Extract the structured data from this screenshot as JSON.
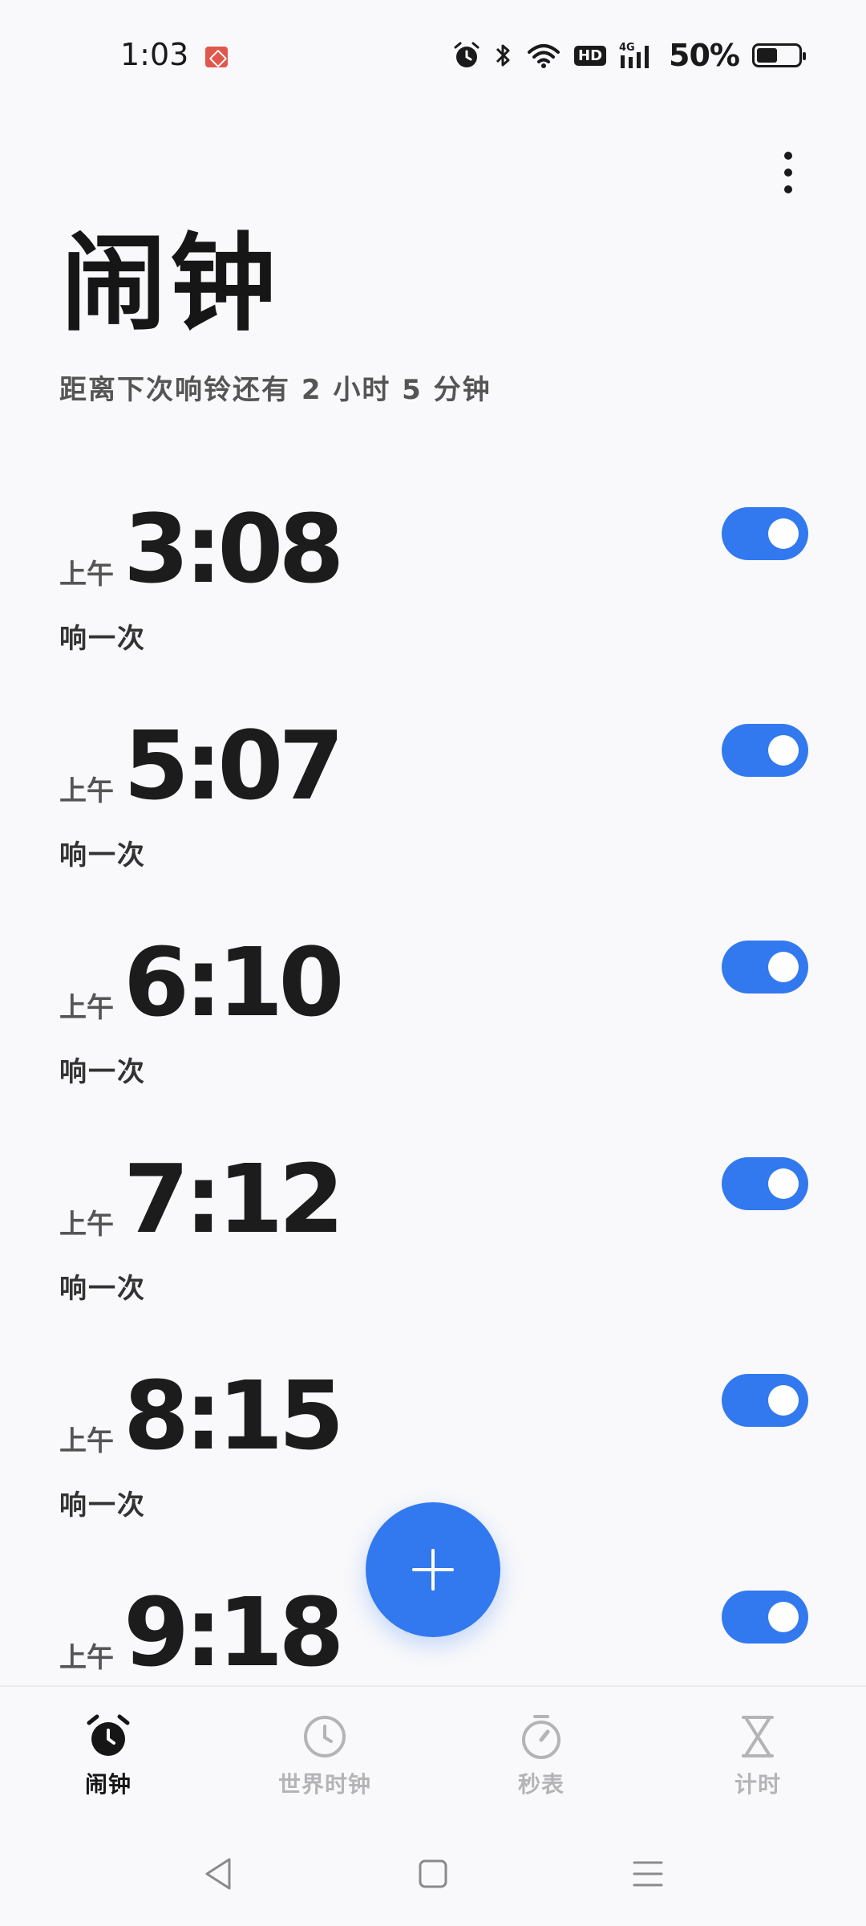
{
  "status_bar": {
    "time": "1:03",
    "battery_percent": "50%",
    "network": "4G",
    "hd_label": "HD",
    "battery_level": 0.5
  },
  "header": {
    "title": "闹钟",
    "subtitle": "距离下次响铃还有 2 小时 5 分钟"
  },
  "alarms": [
    {
      "ampm": "上午",
      "time": "3:08",
      "repeat": "响一次",
      "enabled": true
    },
    {
      "ampm": "上午",
      "time": "5:07",
      "repeat": "响一次",
      "enabled": true
    },
    {
      "ampm": "上午",
      "time": "6:10",
      "repeat": "响一次",
      "enabled": true
    },
    {
      "ampm": "上午",
      "time": "7:12",
      "repeat": "响一次",
      "enabled": true
    },
    {
      "ampm": "上午",
      "time": "8:15",
      "repeat": "响一次",
      "enabled": true
    },
    {
      "ampm": "上午",
      "time": "9:18",
      "repeat": "",
      "enabled": true
    }
  ],
  "tabs": [
    {
      "label": "闹钟",
      "icon": "alarm-clock-icon",
      "active": true
    },
    {
      "label": "世界时钟",
      "icon": "clock-icon",
      "active": false
    },
    {
      "label": "秒表",
      "icon": "stopwatch-icon",
      "active": false
    },
    {
      "label": "计时",
      "icon": "hourglass-icon",
      "active": false
    }
  ],
  "colors": {
    "accent": "#3279F0",
    "background": "#F9F9FB",
    "inactive_tab": "#B4B4B8"
  }
}
